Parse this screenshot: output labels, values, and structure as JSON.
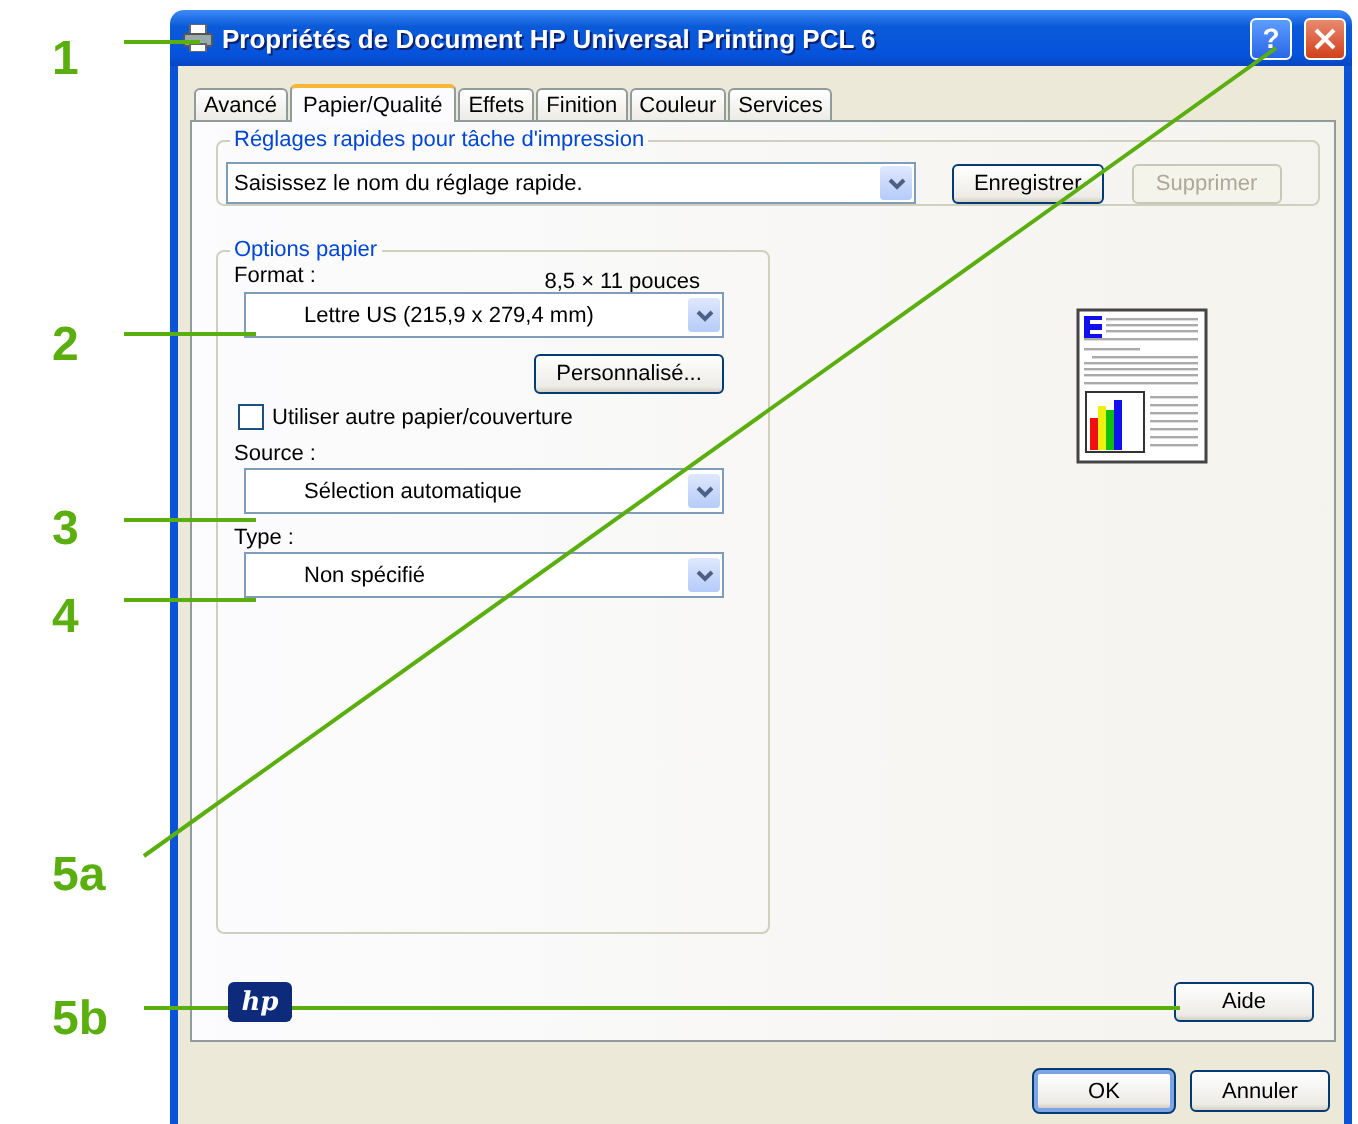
{
  "callouts": [
    {
      "label": "1"
    },
    {
      "label": "2"
    },
    {
      "label": "3"
    },
    {
      "label": "4"
    },
    {
      "label": "5a"
    },
    {
      "label": "5b"
    }
  ],
  "window": {
    "title": "Propriétés de Document HP Universal Printing PCL 6",
    "help_glyph": "?"
  },
  "tabs": [
    {
      "label": "Avancé",
      "selected": false
    },
    {
      "label": "Papier/Qualité",
      "selected": true
    },
    {
      "label": "Effets",
      "selected": false
    },
    {
      "label": "Finition",
      "selected": false
    },
    {
      "label": "Couleur",
      "selected": false
    },
    {
      "label": "Services",
      "selected": false
    }
  ],
  "quick_settings": {
    "legend": "Réglages rapides pour tâche d'impression",
    "value": "Saisissez le nom du réglage rapide.",
    "buttons": [
      {
        "label": "Enregistrer",
        "disabled": false
      },
      {
        "label": "Supprimer",
        "disabled": true
      }
    ]
  },
  "paper_options": {
    "legend": "Options papier",
    "format_label": "Format :",
    "size_reading": "8,5 × 11 pouces",
    "format_value": "Lettre US (215,9 x 279,4 mm)",
    "custom_button": "Personnalisé...",
    "checkbox": {
      "label": "Utiliser autre papier/couverture",
      "checked": false
    },
    "source_label": "Source :",
    "source_value": "Sélection automatique",
    "type_label": "Type :",
    "type_value": "Non spécifié"
  },
  "logo": "hp",
  "help_button": "Aide",
  "buttons": [
    {
      "label": "OK",
      "default": true
    },
    {
      "label": "Annuler",
      "default": false
    }
  ]
}
